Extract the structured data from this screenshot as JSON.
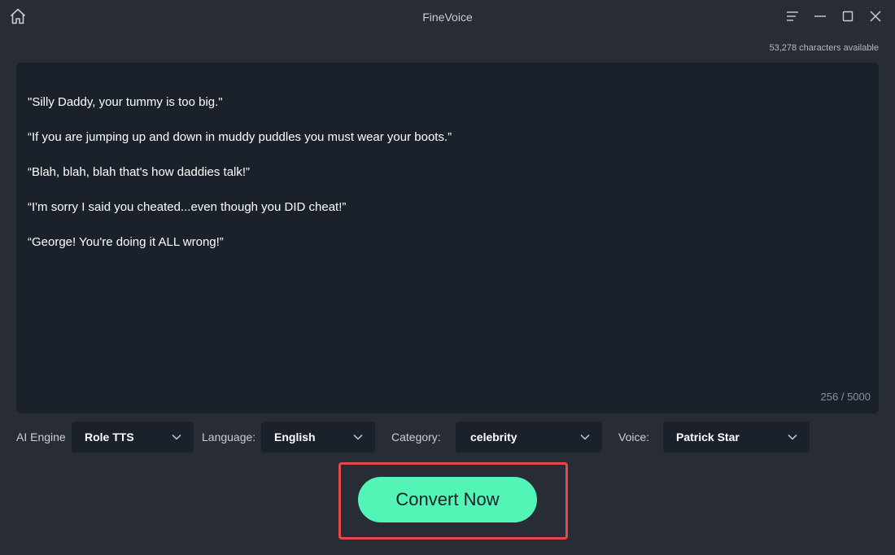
{
  "window": {
    "title": "FineVoice"
  },
  "header": {
    "chars_available": "53,278 characters available"
  },
  "editor": {
    "lines": [
      "\"Silly Daddy, your tummy is too big.\"",
      "“If you are jumping up and down in muddy puddles you must wear your boots.”",
      "“Blah, blah, blah that's how daddies talk!”",
      "“I'm sorry I said you cheated...even though you DID cheat!”",
      "“George! You're doing it ALL wrong!”"
    ],
    "counter": "256 / 5000"
  },
  "options": {
    "ai_engine_label": "AI Engine",
    "ai_engine_value": "Role TTS",
    "language_label": "Language:",
    "language_value": "English",
    "category_label": "Category:",
    "category_value": "celebrity",
    "voice_label": "Voice:",
    "voice_value": "Patrick Star"
  },
  "actions": {
    "convert_label": "Convert Now"
  },
  "colors": {
    "background": "#272c35",
    "editor_bg": "#1b212b",
    "accent": "#52f5b5",
    "highlight_frame": "#e4484d"
  },
  "icons": {
    "home": "home-icon",
    "menu": "menu-icon",
    "minimize": "minimize-icon",
    "maximize": "maximize-icon",
    "close": "close-icon",
    "dropdown": "chevron-down-icon"
  }
}
